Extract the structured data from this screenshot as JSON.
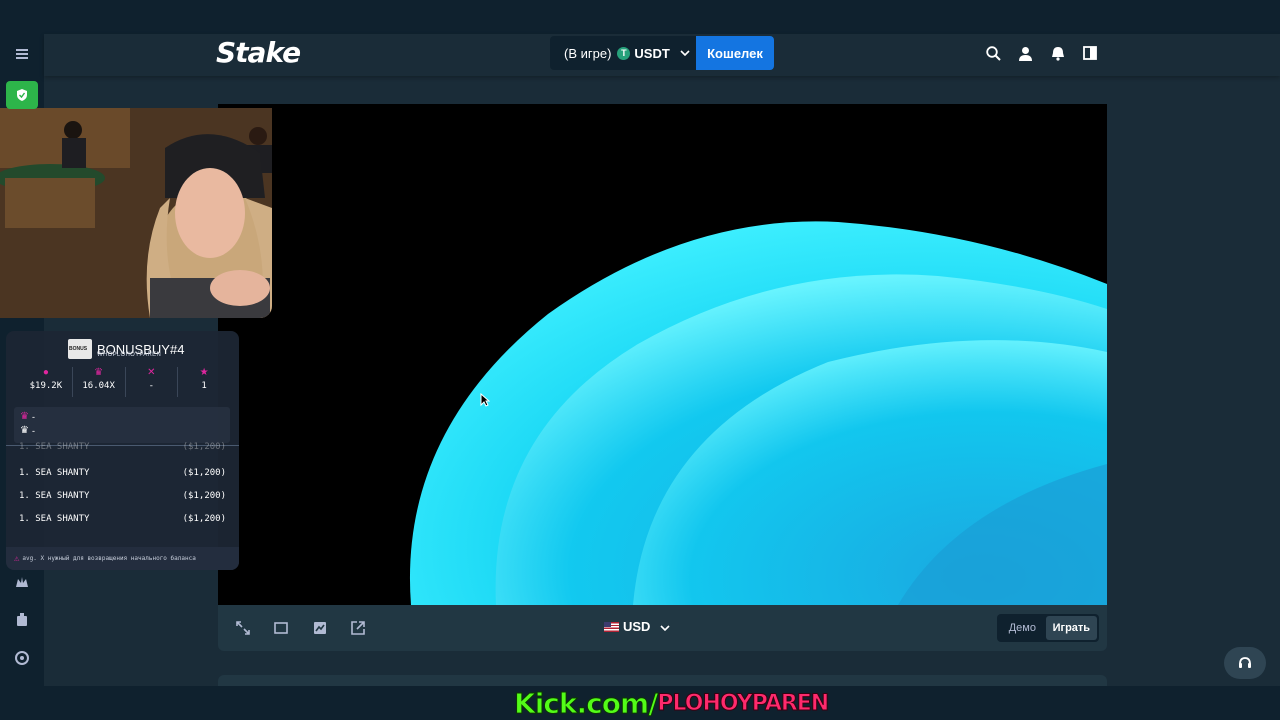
{
  "header": {
    "logo": "Stake",
    "balance_status": "(В игре)",
    "currency": "USDT",
    "currency_coin": "T",
    "wallet_label": "Кошелек"
  },
  "controls": {
    "currency_label": "USD",
    "demo_label": "Демо",
    "play_label": "Играть"
  },
  "overlay": {
    "kick_domain": "Kick.com/",
    "kick_user": "PLOHOYPAREN"
  },
  "bonus_panel": {
    "title": "BONUSBUY#4",
    "subtitle": "WHOPLOHOYPAREN",
    "stats": [
      {
        "icon": "coin-icon",
        "value": "$19.2K"
      },
      {
        "icon": "multiplier-icon",
        "value": "16.04X"
      },
      {
        "icon": "cross-icon",
        "value": "-"
      },
      {
        "icon": "star-icon",
        "value": "1"
      }
    ],
    "best": [
      {
        "icon": "crown-pink-icon",
        "value": "-"
      },
      {
        "icon": "crown-white-icon",
        "value": "-"
      }
    ],
    "list": [
      {
        "name": "1. SEA SHANTY",
        "amount": "($1,200)"
      },
      {
        "name": "1. SEA SHANTY",
        "amount": "($1,200)"
      },
      {
        "name": "1. SEA SHANTY",
        "amount": "($1,200)"
      }
    ],
    "footer": "avg. X нужный для возвращения начального баланса"
  },
  "colors": {
    "bg": "#1a2c38",
    "dark": "#0f212e",
    "accent_blue": "#1475e1",
    "kick_green": "#53fc18",
    "pink": "#e0269f",
    "game_cyan": "#00d8f0"
  }
}
